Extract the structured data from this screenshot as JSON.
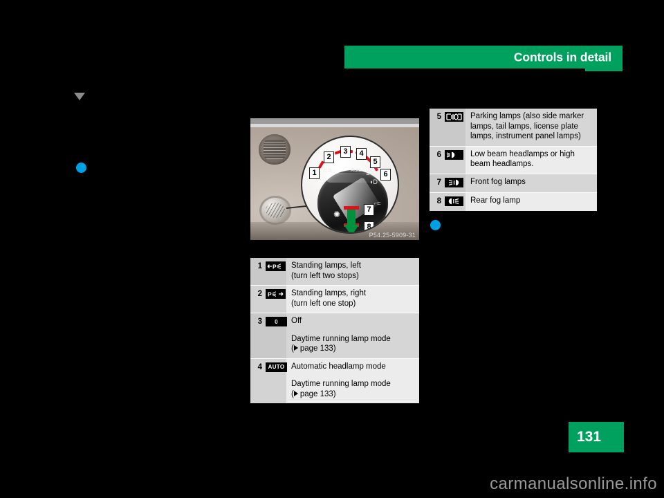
{
  "header": {
    "chapter_title": "Controls in detail"
  },
  "figure": {
    "caption": "P54.25-5909-31",
    "callouts": [
      "1",
      "2",
      "3",
      "4",
      "5",
      "6",
      "7",
      "8"
    ],
    "dial_labels": [
      "0",
      "Auto"
    ]
  },
  "legend_top": {
    "rows": [
      {
        "number": "5",
        "icon": "parking-lamps-icon",
        "icon_text": "",
        "lines": [
          "Parking lamps (also side marker",
          "lamps, tail lamps, license plate",
          "lamps, instrument panel lamps)"
        ]
      },
      {
        "number": "6",
        "icon": "low-beam-headlamp-icon",
        "icon_text": "",
        "lines": [
          "Low beam headlamps or high",
          "beam headlamps."
        ]
      },
      {
        "number": "7",
        "icon": "front-fog-lamp-icon",
        "icon_text": "",
        "lines": [
          "Front fog lamps"
        ]
      },
      {
        "number": "8",
        "icon": "rear-fog-lamp-icon",
        "icon_text": "",
        "lines": [
          "Rear fog lamp"
        ]
      }
    ]
  },
  "legend_bottom": {
    "rows": [
      {
        "number": "1",
        "icon": "standing-lamps-left-icon",
        "icon_text": "",
        "lines": [
          "Standing lamps, left",
          "(turn left two stops)"
        ]
      },
      {
        "number": "2",
        "icon": "standing-lamps-right-icon",
        "icon_text": "",
        "lines": [
          "Standing lamps, right",
          "(turn left one stop)"
        ]
      },
      {
        "number": "3",
        "icon": "off-position-icon",
        "icon_text": "0",
        "lines": [
          "Off"
        ],
        "extra_lines": [
          "Daytime running lamp mode",
          "page 133"
        ],
        "pageref_prefix": "(",
        "pageref_text": "page 133)"
      },
      {
        "number": "4",
        "icon": "auto-headlamp-icon",
        "icon_text": "AUTO",
        "lines": [
          "Automatic headlamp mode"
        ],
        "extra_lines": [
          "Daytime running lamp mode",
          "page 133"
        ],
        "pageref_prefix": "(",
        "pageref_text": "page 133)"
      }
    ]
  },
  "footer": {
    "page_number": "131",
    "watermark": "carmanualsonline.info"
  },
  "colors": {
    "brand_green": "#00a15e",
    "accent_blue": "#00a0e4",
    "marker_gray": "#8c8c8c",
    "tick_red": "#e2101a",
    "arrow_green": "#00913f"
  }
}
